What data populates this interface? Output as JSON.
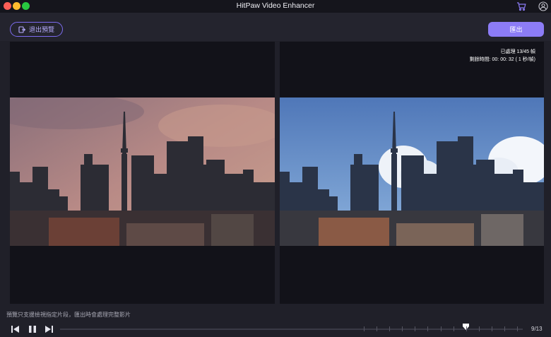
{
  "window": {
    "title": "HitPaw Video Enhancer"
  },
  "toolbar": {
    "exit_preview_label": "退出預覽",
    "export_label": "匯出"
  },
  "preview": {
    "processed_text": "已處理 13/45 幀",
    "remaining_text": "剩餘時間: 00: 00: 32 ( 1 秒/幀)"
  },
  "footer": {
    "hint": "預覽只支援檢視指定片段，匯出時會處理完整影片",
    "frame_counter": "9/13",
    "current_frame": 9,
    "total_frames": 13
  },
  "colors": {
    "accent": "#8c7cf6",
    "panel_bg": "#121219",
    "app_bg": "#202029"
  },
  "icons": [
    "cart-icon",
    "user-icon",
    "exit-icon",
    "previous-frame-icon",
    "pause-icon",
    "next-frame-icon",
    "playhead-icon"
  ]
}
